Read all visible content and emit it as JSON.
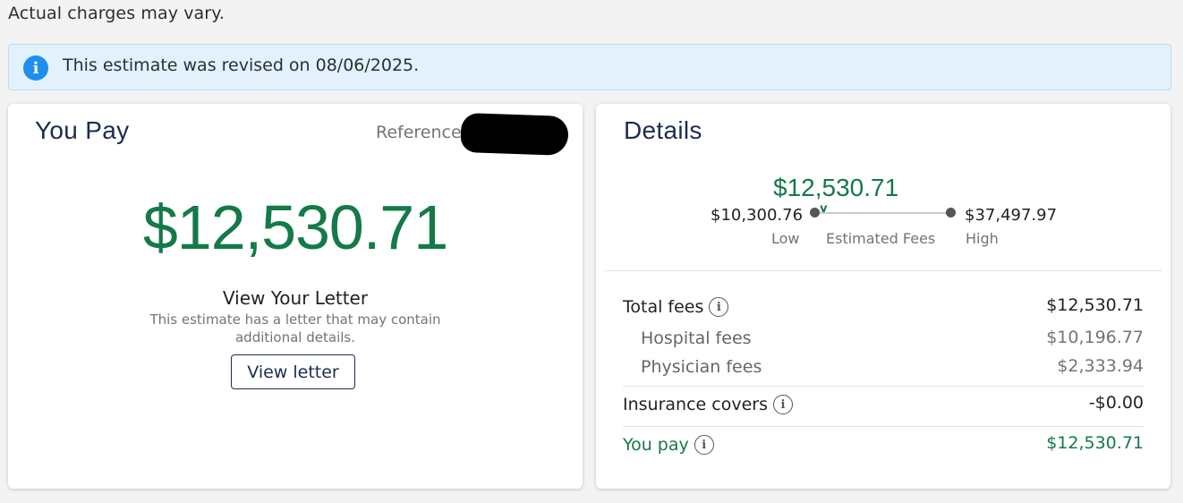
{
  "disclaimer": "Actual charges may vary.",
  "notice": {
    "text": "This estimate was revised on 08/06/2025.",
    "icon": "info-icon",
    "color": "#1e8ef0"
  },
  "you_pay_card": {
    "title": "You Pay",
    "reference_label": "Reference",
    "amount": "$12,530.71",
    "letter_title": "View Your Letter",
    "letter_desc": "This estimate has a letter that may contain additional details.",
    "view_letter_label": "View letter"
  },
  "details_card": {
    "title": "Details",
    "range": {
      "estimated": "$12,530.71",
      "low": "$10,300.76",
      "high": "$37,497.97",
      "low_label": "Low",
      "estimated_label": "Estimated Fees",
      "high_label": "High",
      "estimate_position": 0.04
    },
    "rows": {
      "total_fees": {
        "label": "Total fees",
        "value": "$12,530.71"
      },
      "hospital_fees": {
        "label": "Hospital fees",
        "value": "$10,196.77"
      },
      "physician_fees": {
        "label": "Physician fees",
        "value": "$2,333.94"
      },
      "insurance_covers": {
        "label": "Insurance covers",
        "value": "-$0.00"
      },
      "you_pay": {
        "label": "You pay",
        "value": "$12,530.71"
      }
    }
  },
  "colors": {
    "accent_green": "#137a48",
    "navy": "#1b2c4f"
  }
}
